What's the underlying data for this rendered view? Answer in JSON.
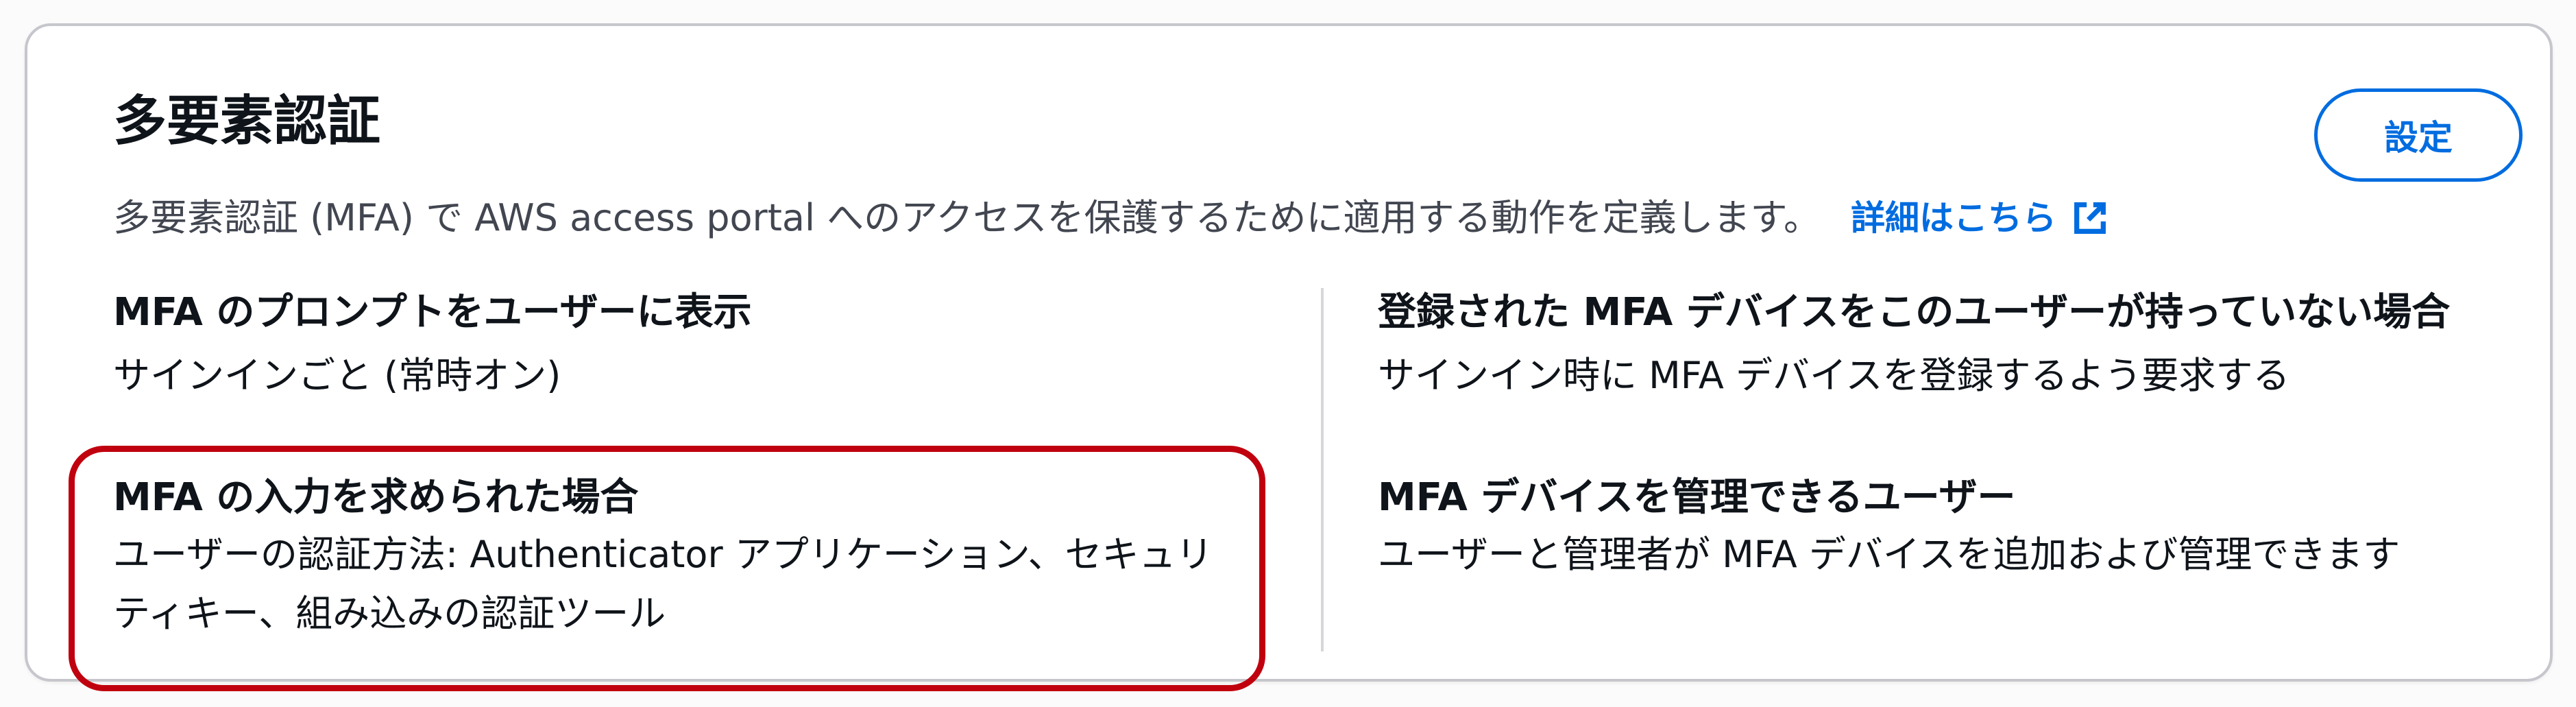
{
  "section": {
    "title": "多要素認証",
    "settings_button_label": "設定",
    "description": "多要素認証 (MFA) で AWS access portal へのアクセスを保護するために適用する動作を定義します。",
    "learn_more_label": "詳細はこちら"
  },
  "settings": [
    {
      "label": "MFA のプロンプトをユーザーに表示",
      "value": "サインインごと (常時オン)"
    },
    {
      "label": "MFA の入力を求められた場合",
      "value": "ユーザーの認証方法: Authenticator アプリケーション、セキュリティキー、組み込みの認証ツール"
    },
    {
      "label": "登録された MFA デバイスをこのユーザーが持っていない場合",
      "value": "サインイン時に MFA デバイスを登録するよう要求する"
    },
    {
      "label": "MFA デバイスを管理できるユーザー",
      "value": "ユーザーと管理者が MFA デバイスを追加および管理できます"
    }
  ],
  "icons": {
    "external_link": "external-link-icon"
  },
  "colors": {
    "link": "#006ce0",
    "highlight": "#c0000e",
    "text": "#0f141a",
    "secondary_text": "#424650"
  }
}
